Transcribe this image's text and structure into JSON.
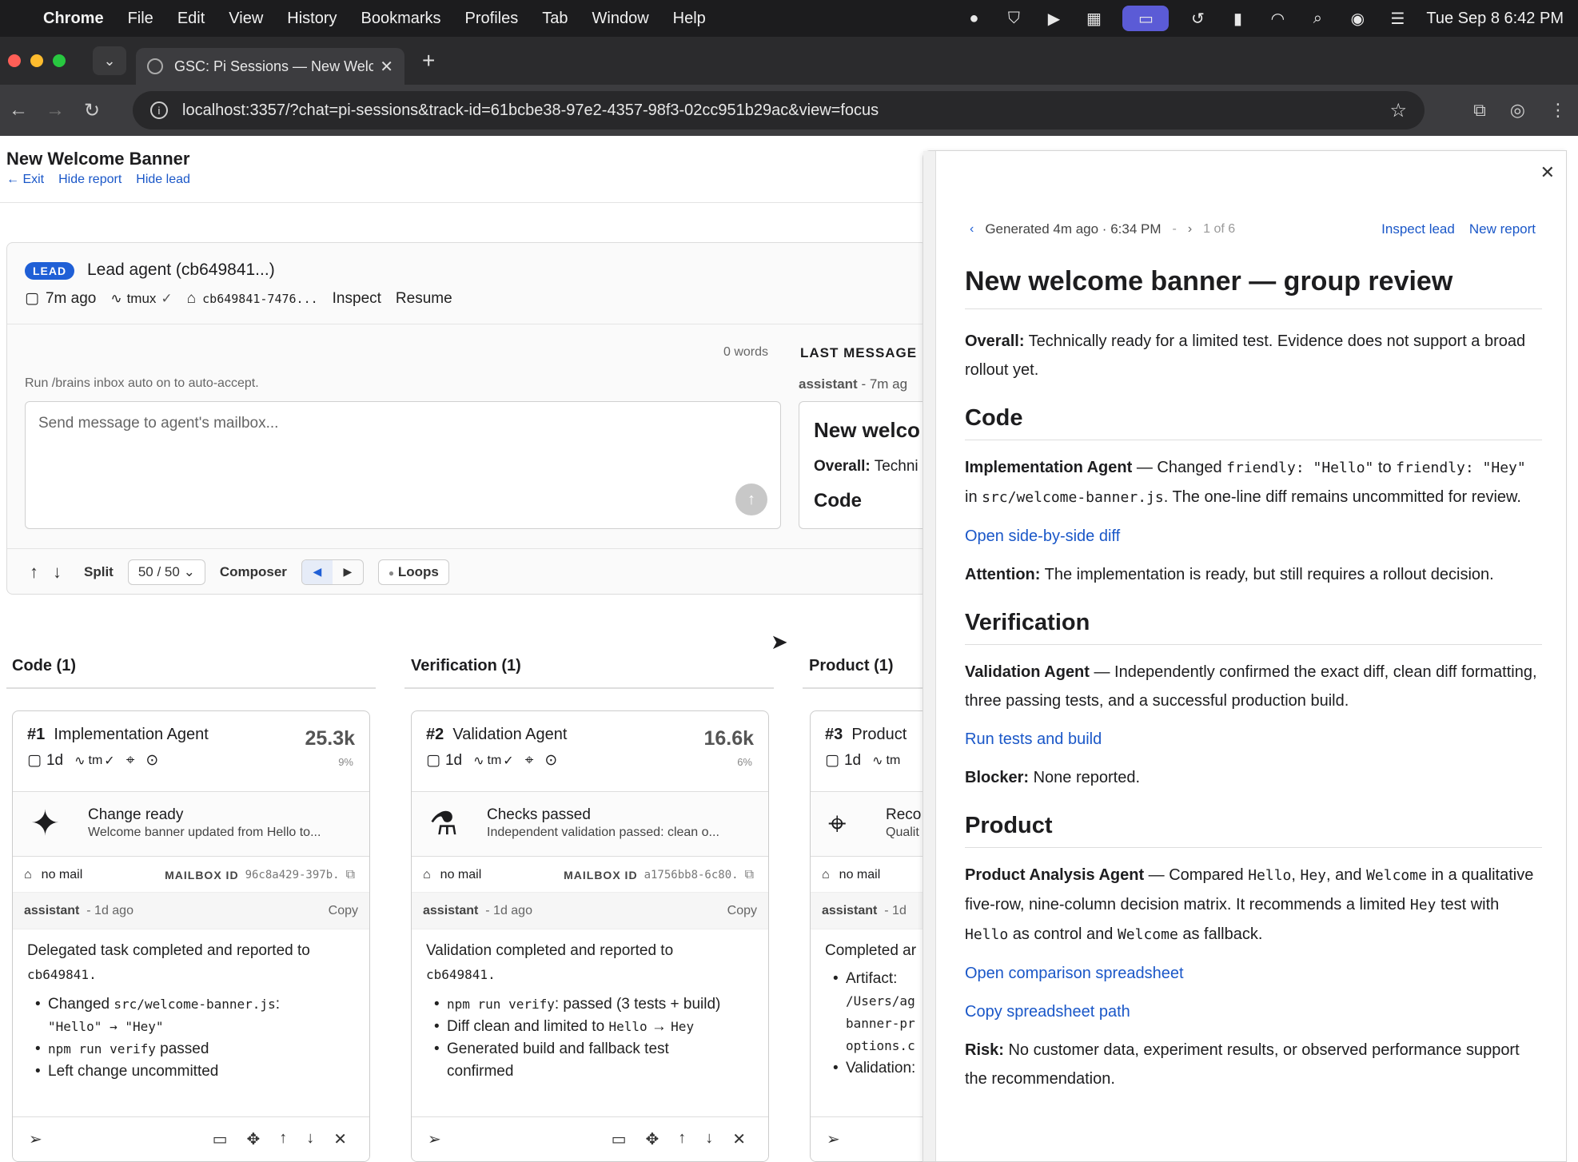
{
  "menubar": {
    "app": "Chrome",
    "items": [
      "File",
      "Edit",
      "View",
      "History",
      "Bookmarks",
      "Profiles",
      "Tab",
      "Window",
      "Help"
    ],
    "clock": "Tue Sep 8  6:42 PM"
  },
  "tab": {
    "title": "GSC: Pi Sessions — New Welc"
  },
  "address": {
    "url": "localhost:3357/?chat=pi-sessions&track-id=61bcbe38-97e2-4357-98f3-02cc951b29ac&view=focus"
  },
  "header": {
    "title": "New Welcome Banner",
    "exit": "← Exit",
    "hide_report": "Hide report",
    "hide_lead": "Hide lead"
  },
  "lead": {
    "badge": "LEAD",
    "name": "Lead agent (cb649841...)",
    "time": "7m ago",
    "tmux": "tmux",
    "session": "cb649841-7476...",
    "inspect": "Inspect",
    "resume": "Resume",
    "words": "0 words",
    "hint": "Run /brains inbox auto on to auto-accept.",
    "placeholder": "Send message to agent's mailbox...",
    "last_message_label": "LAST MESSAGE",
    "last_who": "assistant",
    "last_ago": "- 7m ag",
    "last_heading": "New welco",
    "last_overall_label": "Overall:",
    "last_overall_text": " Techni",
    "last_code": "Code"
  },
  "controls": {
    "split_label": "Split",
    "split_value": "50 / 50",
    "composer_label": "Composer",
    "loops": "Loops"
  },
  "columns": [
    {
      "header": "Code (1)"
    },
    {
      "header": "Verification (1)"
    },
    {
      "header": "Product (1)"
    }
  ],
  "cards": [
    {
      "num": "#1",
      "name": "Implementation Agent",
      "tokens": "25.3k",
      "pct": "9%",
      "age": "1d",
      "tm": "tm",
      "status_title": "Change ready",
      "status_sub": "Welcome banner updated from Hello to...",
      "mail": "no mail",
      "mailbox_label": "MAILBOX ID",
      "mailbox_id": "96c8a429-397b...",
      "who": "assistant",
      "ago": "- 1d ago",
      "copy": "Copy",
      "body_intro": "Delegated task completed and reported to",
      "body_intro2": "cb649841.",
      "b1a": "Changed ",
      "b1code": "src/welcome-banner.js",
      "b1b": ":",
      "b1line2": "\"Hello\" → \"Hey\"",
      "b2code": "npm run verify",
      "b2": " passed",
      "b3": "Left change uncommitted"
    },
    {
      "num": "#2",
      "name": "Validation Agent",
      "tokens": "16.6k",
      "pct": "6%",
      "age": "1d",
      "tm": "tm",
      "status_title": "Checks passed",
      "status_sub": "Independent validation passed: clean o...",
      "mail": "no mail",
      "mailbox_label": "MAILBOX ID",
      "mailbox_id": "a1756bb8-6c80...",
      "who": "assistant",
      "ago": "- 1d ago",
      "copy": "Copy",
      "body_intro": "Validation completed and reported to",
      "body_intro2": "cb649841.",
      "b1code": "npm run verify",
      "b1": ": passed (3 tests + build)",
      "b2a": "Diff clean and limited to ",
      "b2c1": "Hello",
      "b2arrow": " → ",
      "b2c2": "Hey",
      "b3": "Generated build and fallback test",
      "b3b": "confirmed"
    },
    {
      "num": "#3",
      "name": "Product",
      "age": "1d",
      "tm": "tm",
      "status_title": "Reco",
      "status_sub": "Qualit",
      "mail": "no mail",
      "who": "assistant",
      "ago": "- 1d",
      "body_intro": "Completed ar",
      "b1": "Artifact:",
      "b1l2": "/Users/ag",
      "b1l3": "banner-pr",
      "b1l4": "options.c",
      "b2": "Validation:"
    }
  ],
  "report": {
    "generated": "Generated 4m ago · 6:34 PM",
    "dash": "-",
    "pager": "1 of 6",
    "inspect_lead": "Inspect lead",
    "new_report": "New report",
    "title": "New welcome banner — group review",
    "overall_label": "Overall:",
    "overall_text": " Technically ready for a limited test. Evidence does not support a broad rollout yet.",
    "code_h": "Code",
    "code_agent": "Implementation Agent",
    "code_t1": " — Changed ",
    "code_c1": "friendly: \"Hello\"",
    "code_t2": " to ",
    "code_c2": "friendly: \"Hey\"",
    "code_t3": " in ",
    "code_c3": "src/welcome-banner.js",
    "code_t4": ". The one-line diff remains uncommitted for review.",
    "code_link": "Open side-by-side diff",
    "attention_label": "Attention:",
    "attention_text": " The implementation is ready, but still requires a rollout decision.",
    "ver_h": "Verification",
    "ver_agent": "Validation Agent",
    "ver_text": " — Independently confirmed the exact diff, clean diff formatting, three passing tests, and a successful production build.",
    "ver_link": "Run tests and build",
    "blocker_label": "Blocker:",
    "blocker_text": " None reported.",
    "prod_h": "Product",
    "prod_agent": "Product Analysis Agent",
    "prod_t1": " — Compared ",
    "prod_c1": "Hello",
    "prod_t2": ", ",
    "prod_c2": "Hey",
    "prod_t3": ", and ",
    "prod_c3": "Welcome",
    "prod_t4": " in a qualitative five-row, nine-column decision matrix. It recommends a limited ",
    "prod_c4": "Hey",
    "prod_t5": " test with ",
    "prod_c5": "Hello",
    "prod_t6": " as control and ",
    "prod_c6": "Welcome",
    "prod_t7": " as fallback.",
    "prod_link1": "Open comparison spreadsheet",
    "prod_link2": "Copy spreadsheet path",
    "risk_label": "Risk:",
    "risk_text": " No customer data, experiment results, or observed performance support the recommendation."
  },
  "colors": {
    "accent": "#1a57c8",
    "badge": "#1f5fd6"
  }
}
